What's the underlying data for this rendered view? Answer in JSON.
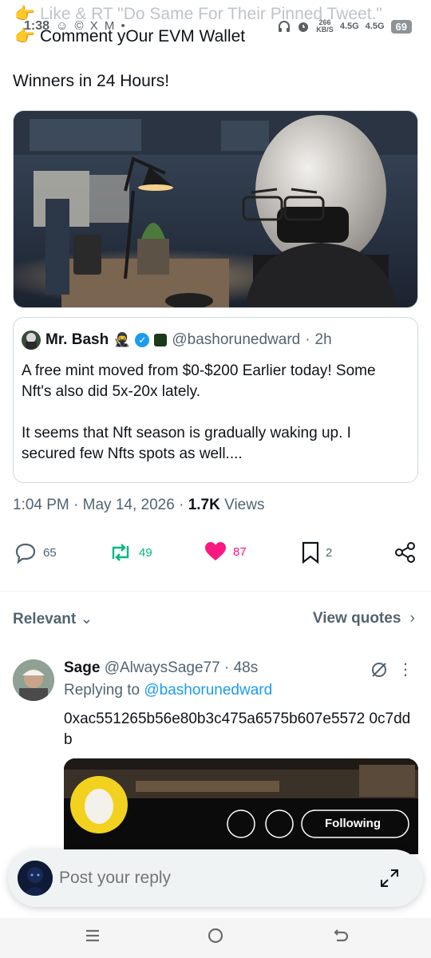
{
  "status_bar": {
    "time": "1:38",
    "left_icons": "☺ © X M •",
    "net_speed": "266",
    "net_unit": "KB/S",
    "signal1": "4.5G",
    "signal2": "4.5G",
    "battery": "69"
  },
  "tweet": {
    "line1": "👉 Like & RT \"Do Same For Their Pinned Tweet.\"",
    "line2": "👉 Comment yOur EVM Wallet",
    "winners": "Winners in 24 Hours!",
    "meta_time": "1:04 PM",
    "meta_sep": "·",
    "meta_date": "May 14, 2026",
    "meta_views_count": "1.7K",
    "meta_views_label": "Views"
  },
  "quote": {
    "name": "Mr. Bash",
    "handle": "@bashorunedward",
    "age": "2h",
    "body_p1": "A free mint moved from $0-$200 Earlier today! Some Nft's also did 5x-20x lately.",
    "body_p2": "It seems that Nft season is gradually waking up. I secured few Nfts spots as well...."
  },
  "actions": {
    "replies": "65",
    "reposts": "49",
    "likes": "87",
    "bookmarks": "2"
  },
  "replies_header": {
    "sort_label": "Relevant",
    "view_quotes": "View quotes"
  },
  "reply": {
    "name": "Sage",
    "handle": "@AlwaysSage77",
    "age": "48s",
    "replying_prefix": "Replying to",
    "replying_to": "@bashorunedward",
    "text": "0xac551265b56e80b3c475a6575b607e5572 0c7ddb",
    "media_button": "Following"
  },
  "composer": {
    "placeholder": "Post your reply"
  },
  "colors": {
    "blue": "#1d9bf0",
    "green": "#00ba7c",
    "pink": "#f91880",
    "gray": "#536471"
  }
}
